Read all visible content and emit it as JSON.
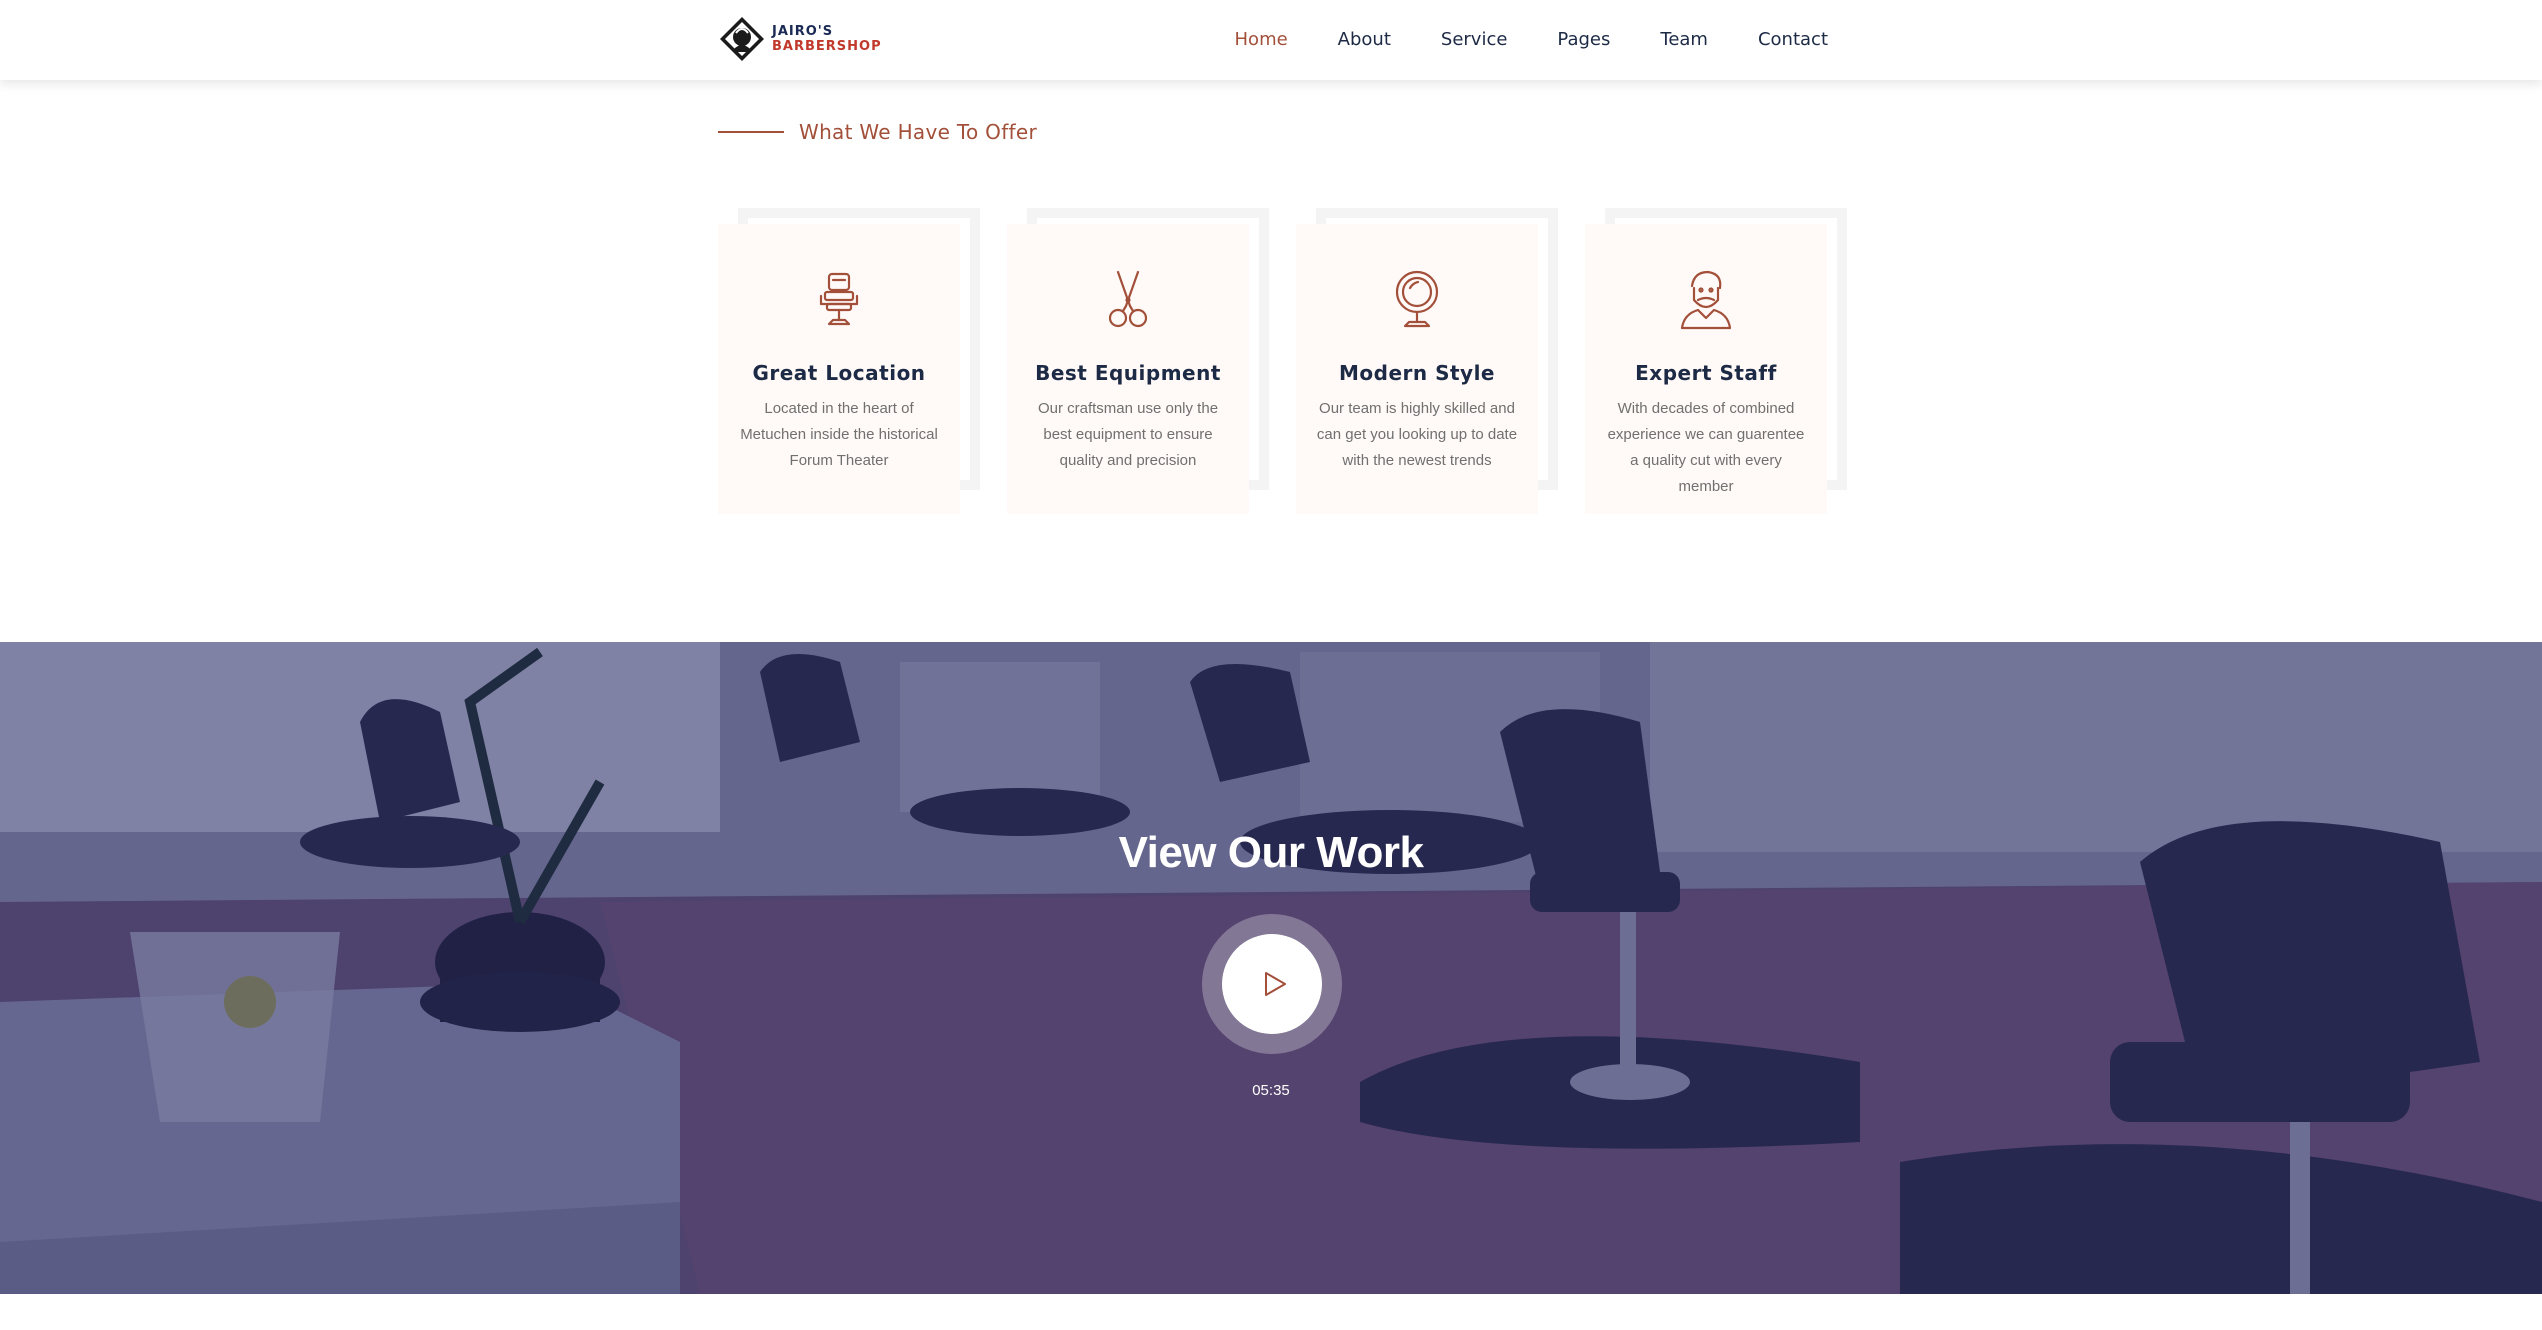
{
  "header": {
    "logo": {
      "line1": "JAIRO'S",
      "line2": "BARBERSHOP"
    },
    "nav": [
      {
        "label": "Home",
        "active": true
      },
      {
        "label": "About",
        "active": false
      },
      {
        "label": "Service",
        "active": false
      },
      {
        "label": "Pages",
        "active": false
      },
      {
        "label": "Team",
        "active": false
      },
      {
        "label": "Contact",
        "active": false
      }
    ]
  },
  "offer": {
    "heading": "What We Have To Offer",
    "cards": [
      {
        "icon": "barber-chair-icon",
        "title": "Great Location",
        "description": "Located in the heart of Metuchen inside the historical Forum Theater"
      },
      {
        "icon": "scissors-icon",
        "title": "Best Equipment",
        "description": "Our craftsman use only the best equipment to ensure quality and precision"
      },
      {
        "icon": "mirror-icon",
        "title": "Modern Style",
        "description": "Our team is highly skilled and can get you looking up to date with the newest trends"
      },
      {
        "icon": "barber-person-icon",
        "title": "Expert Staff",
        "description": "With decades of combined experience we can guarentee a quality cut with every member"
      }
    ]
  },
  "video": {
    "title": "View Our Work",
    "duration": "05:35",
    "play_icon": "play-icon"
  },
  "colors": {
    "accent": "#a2503a",
    "heading": "#1d2a45",
    "card_bg": "#fff9f7",
    "overlay": "#23266a"
  }
}
